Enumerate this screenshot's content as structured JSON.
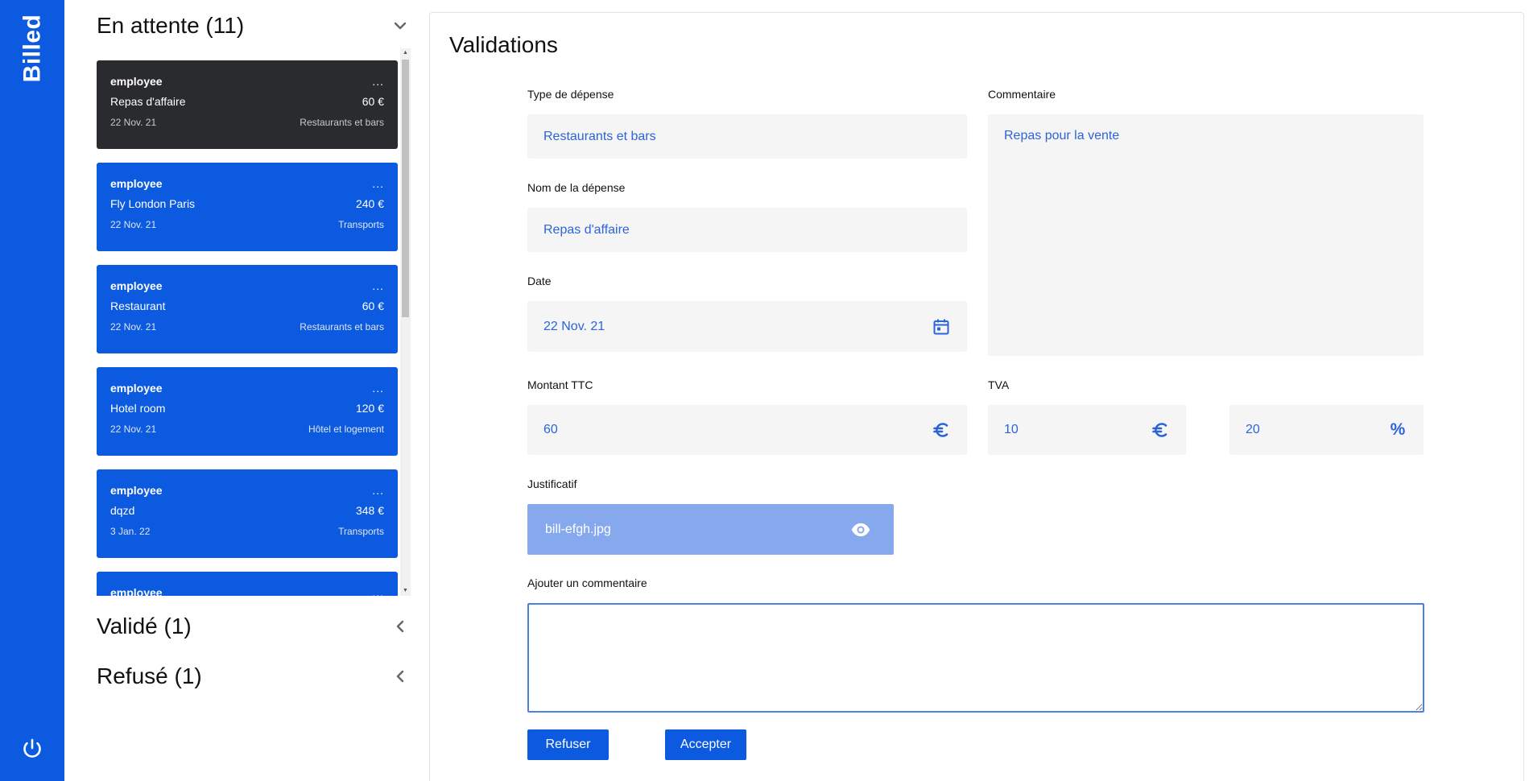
{
  "app": {
    "brand": "Billed"
  },
  "colors": {
    "primary": "#0b5ae0",
    "active_card": "#2a2b2f",
    "field_bg": "#f5f5f5",
    "field_text": "#2c64d8",
    "proof_bg": "#86a9ee"
  },
  "groups": {
    "pending": {
      "title": "En attente (11)",
      "chevron": "chevron-down-icon"
    },
    "validated": {
      "title": "Validé (1)",
      "chevron": "chevron-left-icon"
    },
    "refused": {
      "title": "Refusé (1)",
      "chevron": "chevron-left-icon"
    }
  },
  "bills": [
    {
      "email": "employee",
      "dots": "...",
      "name": "Repas d'affaire",
      "amount": "60 €",
      "date": "22 Nov. 21",
      "type": "Restaurants et bars"
    },
    {
      "email": "employee",
      "dots": "...",
      "name": "Fly London Paris",
      "amount": "240 €",
      "date": "22 Nov. 21",
      "type": "Transports"
    },
    {
      "email": "employee",
      "dots": "...",
      "name": "Restaurant",
      "amount": "60 €",
      "date": "22 Nov. 21",
      "type": "Restaurants et bars"
    },
    {
      "email": "employee",
      "dots": "...",
      "name": "Hotel room",
      "amount": "120 €",
      "date": "22 Nov. 21",
      "type": "Hôtel et logement"
    },
    {
      "email": "employee",
      "dots": "...",
      "name": "dqzd",
      "amount": "348 €",
      "date": "3 Jan. 22",
      "type": "Transports"
    },
    {
      "email": "employee",
      "dots": "...",
      "name": "",
      "amount": "",
      "date": "",
      "type": ""
    }
  ],
  "detail": {
    "title": "Validations",
    "type_label": "Type de dépense",
    "type_value": "Restaurants et bars",
    "name_label": "Nom de la dépense",
    "name_value": "Repas d'affaire",
    "date_label": "Date",
    "date_value": "22 Nov. 21",
    "comment_label": "Commentaire",
    "comment_value": "Repas pour la vente",
    "amount_label": "Montant TTC",
    "amount_value": "60",
    "vat_label": "TVA",
    "vat_amount": "10",
    "vat_pct": "20",
    "proof_label": "Justificatif",
    "proof_file": "bill-efgh.jpg",
    "add_comment_label": "Ajouter un commentaire",
    "add_comment_value": "",
    "refuse_label": "Refuser",
    "accept_label": "Accepter"
  }
}
